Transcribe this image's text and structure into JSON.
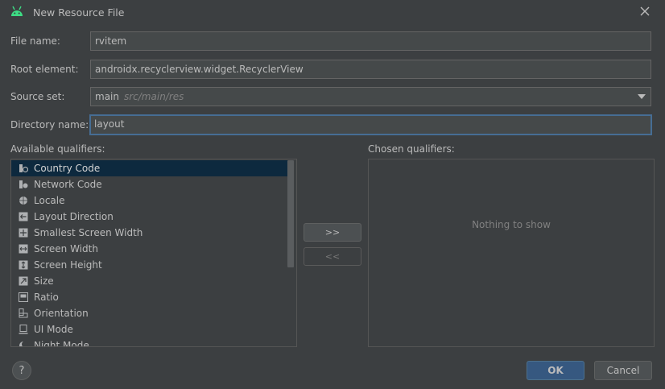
{
  "window": {
    "title": "New Resource File",
    "icon": "android-icon",
    "accent": "#466d94"
  },
  "form": {
    "file_name_label": "File name:",
    "file_name_value": "rvitem",
    "root_element_label": "Root element:",
    "root_element_value": "androidx.recyclerview.widget.RecyclerView",
    "source_set_label": "Source set:",
    "source_set_value": "main",
    "source_set_hint": "src/main/res",
    "directory_name_label": "Directory name:",
    "directory_name_value": "layout"
  },
  "qualifiers": {
    "available_label": "Available qualifiers:",
    "chosen_label": "Chosen qualifiers:",
    "empty_text": "Nothing to show",
    "add_button": ">>",
    "remove_button": "<<",
    "items": [
      {
        "label": "Country Code",
        "icon": "country-code-icon",
        "selected": true
      },
      {
        "label": "Network Code",
        "icon": "network-code-icon",
        "selected": false
      },
      {
        "label": "Locale",
        "icon": "globe-icon",
        "selected": false
      },
      {
        "label": "Layout Direction",
        "icon": "layout-direction-icon",
        "selected": false
      },
      {
        "label": "Smallest Screen Width",
        "icon": "smallest-width-icon",
        "selected": false
      },
      {
        "label": "Screen Width",
        "icon": "screen-width-icon",
        "selected": false
      },
      {
        "label": "Screen Height",
        "icon": "screen-height-icon",
        "selected": false
      },
      {
        "label": "Size",
        "icon": "size-icon",
        "selected": false
      },
      {
        "label": "Ratio",
        "icon": "ratio-icon",
        "selected": false
      },
      {
        "label": "Orientation",
        "icon": "orientation-icon",
        "selected": false
      },
      {
        "label": "UI Mode",
        "icon": "ui-mode-icon",
        "selected": false
      },
      {
        "label": "Night Mode",
        "icon": "night-mode-icon",
        "selected": false
      }
    ]
  },
  "footer": {
    "help": "?",
    "ok": "OK",
    "cancel": "Cancel"
  }
}
